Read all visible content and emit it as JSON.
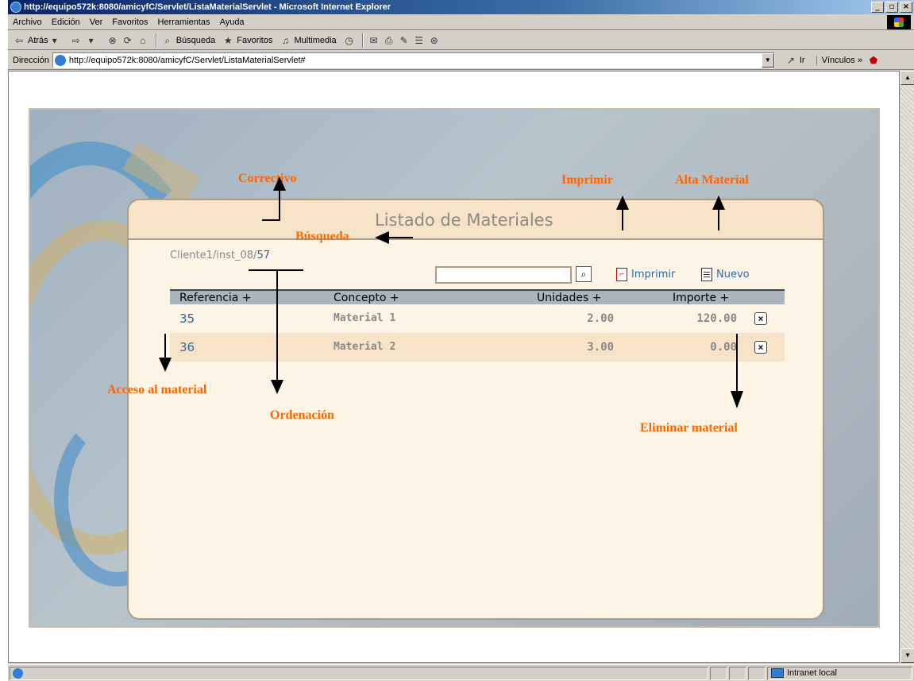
{
  "window": {
    "title": "http://equipo572k:8080/amicyfC/Servlet/ListaMaterialServlet - Microsoft Internet Explorer",
    "buttons": [
      "_",
      "×"
    ]
  },
  "menu": [
    "Archivo",
    "Edición",
    "Ver",
    "Favoritos",
    "Herramientas",
    "Ayuda"
  ],
  "toolbar": {
    "back": "Atrás",
    "search": "Búsqueda",
    "favorites": "Favoritos",
    "multimedia": "Multimedia"
  },
  "address": {
    "label": "Dirección",
    "url": "http://equipo572k:8080/amicyfC/Servlet/ListaMaterialServlet#",
    "go": "Ir",
    "links": "Vínculos"
  },
  "page": {
    "title": "Listado de Materiales",
    "breadcrumb_prefix": "Cliente1/inst_08/",
    "breadcrumb_number": "57",
    "search_value": "",
    "print_label": "Imprimir",
    "new_label": "Nuevo",
    "table": {
      "headers": [
        "Referencia +",
        "Concepto +",
        "Unidades +",
        "Importe +"
      ],
      "rows": [
        {
          "ref": "35",
          "concept": "Material 1",
          "units": "2.00",
          "amount": "120.00"
        },
        {
          "ref": "36",
          "concept": "Material 2",
          "units": "3.00",
          "amount": "0.00"
        }
      ]
    }
  },
  "annotations": {
    "correctivo": "Correctivo",
    "imprimir": "Imprimir",
    "alta_material": "Alta Material",
    "busqueda": "Búsqueda",
    "acceso": "Acceso al material",
    "ordenacion": "Ordenación",
    "eliminar": "Eliminar  material"
  },
  "statusbar": {
    "zone": "Intranet local"
  },
  "colors": {
    "annotation": "#ff6600",
    "link": "#2a6ab0",
    "card_bg": "#fdf4e6",
    "header_bg": "#f7e4c8"
  }
}
